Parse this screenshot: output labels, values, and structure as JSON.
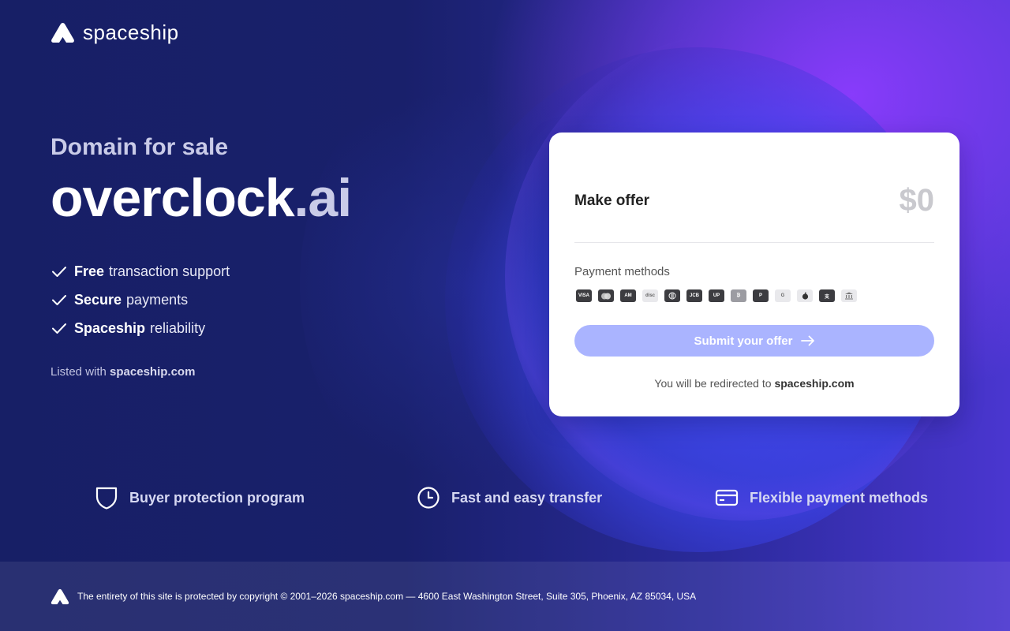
{
  "brand": {
    "name": "spaceship",
    "logo_icon": "spaceship-logo-icon"
  },
  "hero": {
    "subtitle": "Domain for sale",
    "domain_name": "overclock",
    "domain_tld": ".ai"
  },
  "features": [
    {
      "bold": "Free",
      "rest": "transaction support",
      "icon": "check-icon"
    },
    {
      "bold": "Secure",
      "rest": "payments",
      "icon": "check-icon"
    },
    {
      "bold": "Spaceship",
      "rest": "reliability",
      "icon": "check-icon"
    }
  ],
  "listed": {
    "prefix": "Listed with",
    "site": "spaceship.com"
  },
  "card": {
    "offer_label": "Make offer",
    "offer_amount": "$0",
    "payment_methods_label": "Payment methods",
    "payment_icons": [
      "visa-icon",
      "mastercard-icon",
      "amex-icon",
      "discover-icon",
      "diners-icon",
      "jcb-icon",
      "unionpay-icon",
      "bitcoin-icon",
      "paypal-icon",
      "google-pay-icon",
      "apple-pay-icon",
      "alipay-icon",
      "bank-transfer-icon"
    ],
    "submit_label": "Submit your offer",
    "redirect_prefix": "You will be redirected to",
    "redirect_site": "spaceship.com"
  },
  "perks": [
    {
      "label": "Buyer protection program",
      "icon": "shield-icon"
    },
    {
      "label": "Fast and easy transfer",
      "icon": "clock-icon"
    },
    {
      "label": "Flexible payment methods",
      "icon": "credit-card-icon"
    }
  ],
  "footer": {
    "text": "The entirety of this site is protected by copyright © 2001–2026 spaceship.com — 4600 East Washington Street, Suite 305, Phoenix, AZ 85034, USA"
  },
  "colors": {
    "background": "#171f66",
    "accent_purple": "#8c3cff",
    "submit_button": "#aab4ff",
    "card": "#ffffff"
  }
}
